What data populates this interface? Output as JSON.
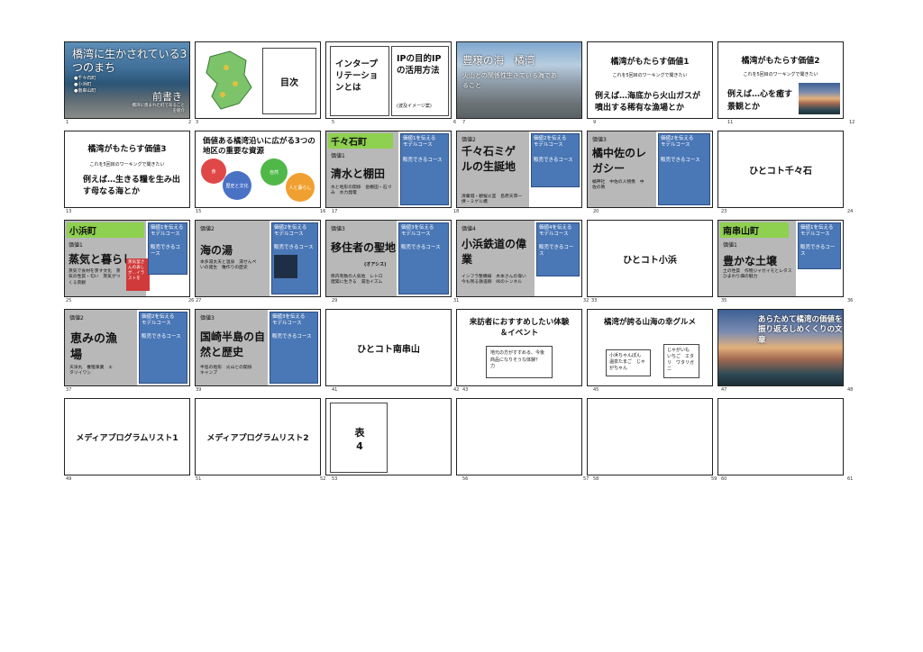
{
  "slides": {
    "s1": {
      "title": "橋湾に生かされている3つのまち",
      "bullets": [
        "●千々石町",
        "●小浜町",
        "●南串山町"
      ],
      "subtitle": "前書き",
      "note": "橋湾に恵まれた町であることを紹介",
      "nums": [
        "1",
        "2"
      ]
    },
    "s2": {
      "title": "目次",
      "nums": [
        "3"
      ]
    },
    "s3": {
      "left": "インタープリテーションとは",
      "right": "IPの目的IPの活用方法",
      "note": "(波及イメージ案)",
      "nums": [
        "5"
      ]
    },
    "s4": {
      "title": "豊穣の海　橘湾",
      "subtitle": "火山との関係性生きている海であること",
      "nums": [
        "6",
        "7"
      ]
    },
    "s5": {
      "title": "橘湾がもたらす価値1",
      "note": "これを5回目のワーキングで聞きたい",
      "body": "例えば…海底から火山ガスが噴出する稀有な漁場とか",
      "nums": [
        "9"
      ]
    },
    "s6": {
      "title": "橘湾がもたらす価値2",
      "note": "これを5回目のワーキングで聞きたい",
      "body": "例えば…心を癒す景観とか",
      "nums": [
        "11",
        "12"
      ]
    },
    "s7": {
      "title": "橘湾がもたらす価値3",
      "note": "これを5回目のワーキングで聞きたい",
      "body": "例えば…生きる糧を生み出す母なる海とか",
      "nums": [
        "13"
      ]
    },
    "s8": {
      "title": "価値ある橘湾沿いに広がる3つの地区の重要な資源",
      "circles": [
        "食",
        "歴史と文化",
        "自然",
        "人と暮らし"
      ],
      "nums": [
        "15"
      ]
    },
    "s9": {
      "tag": "千々石町",
      "label": "価値1",
      "title": "清水と棚田",
      "items": "水と地形の関係　岳棚田・石づみ　水力発電",
      "blue": [
        "価値1を伝える",
        "モデルコース",
        "販売できるコース"
      ],
      "nums": [
        "16",
        "17"
      ]
    },
    "s10": {
      "label": "価値2",
      "title": "千々石ミゲルの生誕地",
      "items": "清藁城・観桜火室　島原天草一揆・ミゲル橋",
      "blue": [
        "価値2を伝える",
        "モデルコース",
        "販売できるコース"
      ],
      "nums": [
        "18"
      ]
    },
    "s11": {
      "label": "価値3",
      "title": "橘中佐のレガシー",
      "items": "橘神社　中佐の人物像　中佐の教",
      "blue": [
        "価値2を伝える",
        "モデルコース",
        "販売できるコース"
      ],
      "nums": [
        "20"
      ]
    },
    "s12": {
      "title": "ひとコト千々石",
      "nums": [
        "23",
        "24"
      ]
    },
    "s13": {
      "tag": "小浜町",
      "label": "価値1",
      "title": "蒸気と暮らし",
      "items": "蒸気で食材を蒸す文化　蒸気の性質・匂い　蒸気がつくる景観",
      "callout": "蒸気釜さんの表しが…イラストを",
      "blue": [
        "価値1を伝える",
        "モデルコース",
        "販売できるコース"
      ],
      "nums": [
        "25",
        "26"
      ]
    },
    "s14": {
      "label": "価値2",
      "title": "海の湯",
      "items": "本多湯太夫と温泉　湯せんぺいの発生　稚作りの歴史",
      "blue": [
        "価値2を伝える",
        "モデルコース",
        "販売できるコース"
      ],
      "nums": [
        "27"
      ]
    },
    "s15": {
      "label": "価値3",
      "title": "移住者の聖地",
      "title_small": "(オアシス)",
      "items": "県内有数の人気地　レトロ建築に生きる　湯治イズム",
      "blue": [
        "価値3を伝える",
        "モデルコース",
        "販売できるコース"
      ],
      "nums": [
        "29"
      ]
    },
    "s16": {
      "label": "価値4",
      "title": "小浜鉄道の偉業",
      "items": "インフラ整備線　木本さんの偉い　今も残る鉄道跡　峠のトンネル",
      "blue": [
        "価値4を伝える",
        "モデルコース",
        "販売できるコース"
      ],
      "nums": [
        "31",
        "32"
      ]
    },
    "s17": {
      "title": "ひとコト小浜",
      "nums": [
        "33"
      ]
    },
    "s18": {
      "tag": "南串山町",
      "label": "価値1",
      "title": "豊かな土壌",
      "items": "土の性質　作物ジャガイモとレタス　ひまわり畑の魅力",
      "blue": [
        "価値1を伝える",
        "モデルコース",
        "販売できるコース"
      ],
      "nums": [
        "35",
        "36"
      ]
    },
    "s19": {
      "label": "価値2",
      "title": "恵みの漁場",
      "items": "天洋丸　養殖事業　エタリイワシ",
      "blue": [
        "価値2を伝える",
        "モデルコース",
        "販売できるコース"
      ],
      "nums": [
        "37"
      ]
    },
    "s20": {
      "label": "価値3",
      "title": "国崎半島の自然と歴史",
      "items": "半島の地形　火山との関係　キャンプ",
      "blue": [
        "価値3を伝える",
        "モデルコース",
        "販売できるコース"
      ],
      "nums": [
        "39"
      ]
    },
    "s21": {
      "title": "ひとコト南串山",
      "nums": [
        "41"
      ]
    },
    "s22": {
      "title": "来訪者におすすめしたい体験＆イベント",
      "box": "地元の方がすすめる、今後商品になりそうな体験？　力",
      "nums": [
        "42",
        "43"
      ]
    },
    "s23": {
      "title": "橘湾が誇る山海の幸グルメ",
      "box1": "小浜ちゃんぽん　温泉たまご　じゃがちゃん",
      "box2": "じゃがいも　いちご　エタリ　ワタリガニ",
      "nums": [
        "45"
      ]
    },
    "s24": {
      "title": "あらためて橘湾の価値を振り返るしめくくりの文章",
      "nums": [
        "47",
        "48"
      ]
    },
    "s25": {
      "title": "メディアプログラムリスト1",
      "nums": [
        "49"
      ]
    },
    "s26": {
      "title": "メディアプログラムリスト2",
      "nums": [
        "51",
        "52"
      ]
    },
    "s27": {
      "title": "表4",
      "nums": [
        "53"
      ]
    },
    "s28": {
      "nums": [
        "56"
      ]
    },
    "s29": {
      "nums": [
        "57",
        "58"
      ]
    },
    "s30": {
      "nums": [
        "59",
        "60"
      ]
    },
    "s31": {
      "nums": [
        "61"
      ]
    }
  }
}
